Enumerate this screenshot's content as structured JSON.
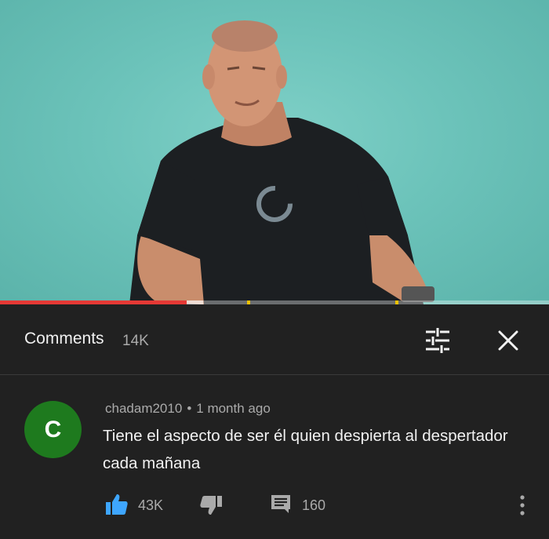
{
  "video": {
    "progress_fraction": 0.34,
    "buffered_fraction": 0.37,
    "chapter_marks": [
      0.45,
      0.72
    ]
  },
  "comments_panel": {
    "title": "Comments",
    "count": "14K",
    "filter_icon": "sort-filter-icon",
    "close_icon": "close-icon"
  },
  "comment": {
    "avatar_letter": "C",
    "avatar_color": "#1e7a1e",
    "author": "chadam2010",
    "separator": "•",
    "time": "1 month ago",
    "text": "Tiene el aspecto de ser él quien despierta al despertador cada mañana",
    "likes": "43K",
    "replies": "160",
    "like_icon": "thumbs-up-icon",
    "dislike_icon": "thumbs-down-icon",
    "reply_icon": "reply-icon",
    "more_icon": "more-vert-icon",
    "accent_color": "#3ea6ff"
  }
}
